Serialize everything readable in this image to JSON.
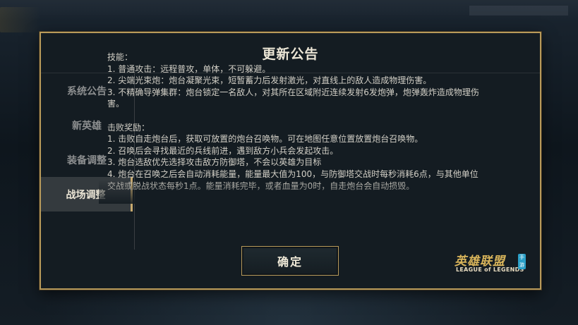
{
  "dialog": {
    "title": "更新公告",
    "confirm_label": "确定"
  },
  "sidebar": {
    "items": [
      {
        "label": "系统公告",
        "active": false
      },
      {
        "label": "新英雄",
        "active": false
      },
      {
        "label": "装备调整",
        "active": false
      },
      {
        "label": "战场调整",
        "active": true
      }
    ]
  },
  "content": {
    "skills_heading": "技能：",
    "skills": [
      "1. 普通攻击：远程普攻，单体，不可躲避。",
      "2. 尖端光束炮：炮台凝聚光束，短暂蓄力后发射激光，对直线上的敌人造成物理伤害。",
      "3. 不精确导弹集群：炮台锁定一名敌人，对其所在区域附近连续发射6发炮弹，炮弹轰炸造成物理伤害。"
    ],
    "rewards_heading": "击败奖励：",
    "rewards": [
      "1. 击败自走炮台后，获取可放置的炮台召唤物。可在地图任意位置放置炮台召唤物。",
      "2. 召唤后会寻找最近的兵线前进，遇到敌方小兵会发起攻击。",
      "3. 炮台选敌优先选择攻击敌方防御塔，不会以英雄为目标",
      "4. 炮台在召唤之后会自动消耗能量，能量最大值为100，与防御塔交战时每秒消耗6点，与其他单位交战或脱战状态每秒1点。能量消耗完毕，或者血量为0时，自走炮台会自动损毁。"
    ]
  },
  "logo": {
    "cn": "英雄联盟",
    "en": "LEAGUE of LEGENDS",
    "badge": "手游"
  },
  "colors": {
    "accent_gold": "#b89a5a",
    "active_tab_bg": "#343a3e",
    "text_main": "#d2cfc6",
    "logo_badge": "#2a9fc7"
  }
}
